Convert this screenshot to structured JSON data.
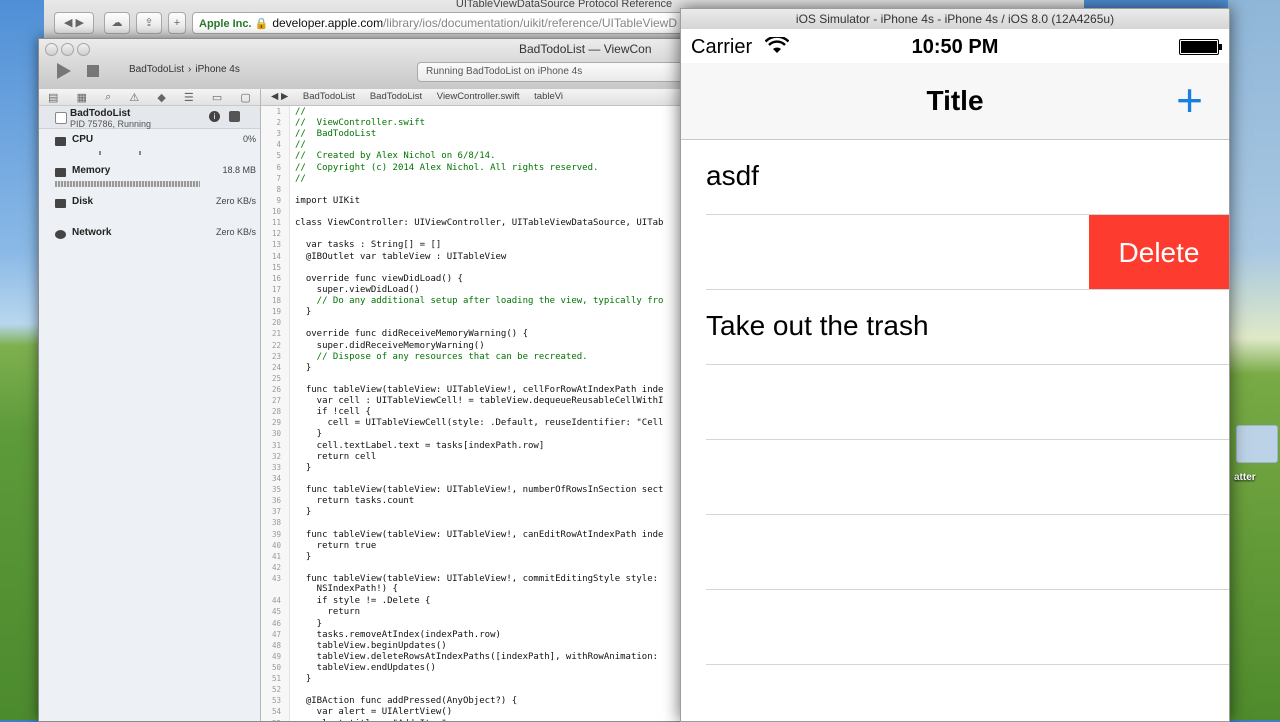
{
  "safari": {
    "window_title": "UITableViewDataSource Protocol Reference",
    "url_badge": "Apple Inc. 🔒",
    "url_host": "developer.apple.com",
    "url_path": "/library/ios/documentation/uikit/reference/UITableViewD"
  },
  "xcode": {
    "doc_title": "BadTodoList — ViewCon",
    "scheme_project": "BadTodoList",
    "scheme_device": "iPhone 4s",
    "activity": "Running BadTodoList on iPhone 4s",
    "jumpbar": [
      "BadTodoList",
      "BadTodoList",
      "ViewController.swift",
      "tableVi"
    ],
    "process": {
      "name": "BadTodoList",
      "sub": "PID 75786, Running"
    },
    "gauges": [
      {
        "name": "CPU",
        "value": "0%"
      },
      {
        "name": "Memory",
        "value": "18.8 MB"
      },
      {
        "name": "Disk",
        "value": "Zero KB/s"
      },
      {
        "name": "Network",
        "value": "Zero KB/s"
      }
    ],
    "code_lines": [
      {
        "n": "1",
        "t": "//"
      },
      {
        "n": "2",
        "t": "//  ViewController.swift"
      },
      {
        "n": "3",
        "t": "//  BadTodoList"
      },
      {
        "n": "4",
        "t": "//"
      },
      {
        "n": "5",
        "t": "//  Created by Alex Nichol on 6/8/14."
      },
      {
        "n": "6",
        "t": "//  Copyright (c) 2014 Alex Nichol. All rights reserved."
      },
      {
        "n": "7",
        "t": "//"
      },
      {
        "n": "8",
        "t": ""
      },
      {
        "n": "9",
        "t": "import UIKit"
      },
      {
        "n": "10",
        "t": ""
      },
      {
        "n": "11",
        "t": "class ViewController: UIViewController, UITableViewDataSource, UITab"
      },
      {
        "n": "12",
        "t": ""
      },
      {
        "n": "13",
        "t": "  var tasks : String[] = []"
      },
      {
        "n": "14",
        "t": "  @IBOutlet var tableView : UITableView"
      },
      {
        "n": "15",
        "t": ""
      },
      {
        "n": "16",
        "t": "  override func viewDidLoad() {"
      },
      {
        "n": "17",
        "t": "    super.viewDidLoad()"
      },
      {
        "n": "18",
        "t": "    // Do any additional setup after loading the view, typically fro"
      },
      {
        "n": "19",
        "t": "  }"
      },
      {
        "n": "20",
        "t": ""
      },
      {
        "n": "21",
        "t": "  override func didReceiveMemoryWarning() {"
      },
      {
        "n": "22",
        "t": "    super.didReceiveMemoryWarning()"
      },
      {
        "n": "23",
        "t": "    // Dispose of any resources that can be recreated."
      },
      {
        "n": "24",
        "t": "  }"
      },
      {
        "n": "25",
        "t": ""
      },
      {
        "n": "26",
        "t": "  func tableView(tableView: UITableView!, cellForRowAtIndexPath inde"
      },
      {
        "n": "27",
        "t": "    var cell : UITableViewCell! = tableView.dequeueReusableCellWithI"
      },
      {
        "n": "28",
        "t": "    if !cell {"
      },
      {
        "n": "29",
        "t": "      cell = UITableViewCell(style: .Default, reuseIdentifier: \"Cell"
      },
      {
        "n": "30",
        "t": "    }"
      },
      {
        "n": "31",
        "t": "    cell.textLabel.text = tasks[indexPath.row]"
      },
      {
        "n": "32",
        "t": "    return cell"
      },
      {
        "n": "33",
        "t": "  }"
      },
      {
        "n": "34",
        "t": ""
      },
      {
        "n": "35",
        "t": "  func tableView(tableView: UITableView!, numberOfRowsInSection sect"
      },
      {
        "n": "36",
        "t": "    return tasks.count"
      },
      {
        "n": "37",
        "t": "  }"
      },
      {
        "n": "38",
        "t": ""
      },
      {
        "n": "39",
        "t": "  func tableView(tableView: UITableView!, canEditRowAtIndexPath inde"
      },
      {
        "n": "40",
        "t": "    return true"
      },
      {
        "n": "41",
        "t": "  }"
      },
      {
        "n": "42",
        "t": ""
      },
      {
        "n": "43",
        "t": "  func tableView(tableView: UITableView!, commitEditingStyle style:"
      },
      {
        "n": "",
        "t": "    NSIndexPath!) {"
      },
      {
        "n": "44",
        "t": "    if style != .Delete {"
      },
      {
        "n": "45",
        "t": "      return"
      },
      {
        "n": "46",
        "t": "    }"
      },
      {
        "n": "47",
        "t": "    tasks.removeAtIndex(indexPath.row)"
      },
      {
        "n": "48",
        "t": "    tableView.beginUpdates()"
      },
      {
        "n": "49",
        "t": "    tableView.deleteRowsAtIndexPaths([indexPath], withRowAnimation:"
      },
      {
        "n": "50",
        "t": "    tableView.endUpdates()"
      },
      {
        "n": "51",
        "t": "  }"
      },
      {
        "n": "52",
        "t": ""
      },
      {
        "n": "53",
        "t": "  @IBAction func addPressed(AnyObject?) {"
      },
      {
        "n": "54",
        "t": "    var alert = UIAlertView()"
      },
      {
        "n": "55",
        "t": "    alert.title = \"Add Item\""
      }
    ]
  },
  "simulator": {
    "window_title": "iOS Simulator - iPhone 4s - iPhone 4s / iOS 8.0 (12A4265u)",
    "carrier": "Carrier",
    "time": "10:50 PM",
    "nav_title": "Title",
    "add_button": "+",
    "rows": [
      "asdf",
      "",
      "Take out the trash",
      "",
      "",
      "",
      ""
    ],
    "delete_label": "Delete"
  },
  "desktop": {
    "folder_label": "atter"
  },
  "colors": {
    "ios_blue": "#1a7ee0",
    "delete_red": "#fd3b2f"
  }
}
